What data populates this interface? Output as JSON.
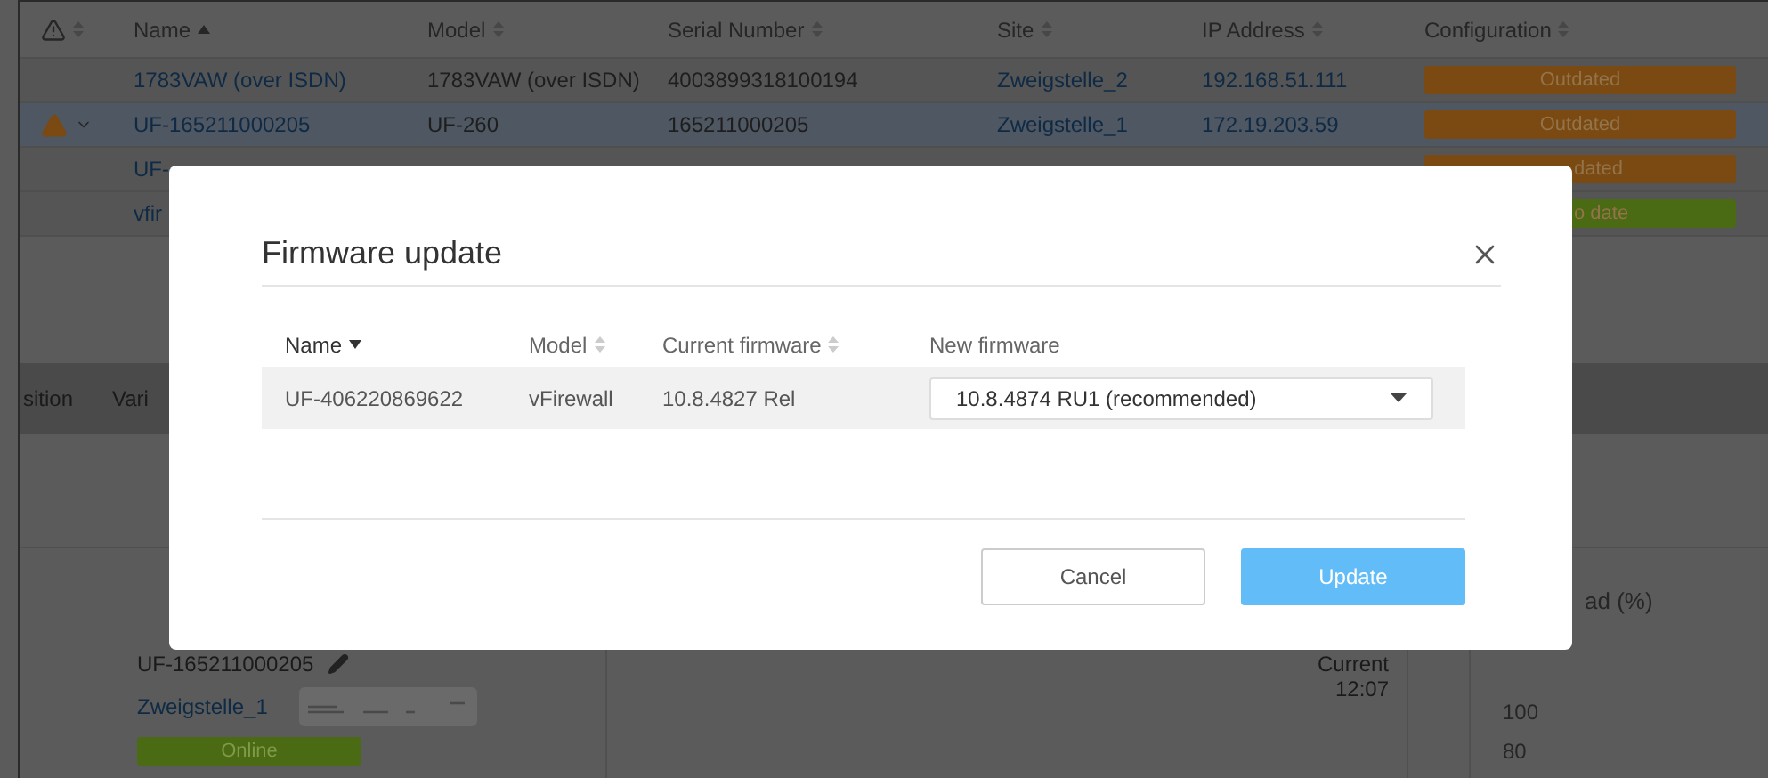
{
  "table": {
    "columns": [
      {
        "kind": "alert",
        "sortable": true,
        "sorted": false
      },
      {
        "kind": "text",
        "label": "Name",
        "sortable": true,
        "sorted": true
      },
      {
        "kind": "text",
        "label": "Model",
        "sortable": true,
        "sorted": false
      },
      {
        "kind": "text",
        "label": "Serial Number",
        "sortable": true,
        "sorted": false
      },
      {
        "kind": "text",
        "label": "Site",
        "sortable": true,
        "sorted": false
      },
      {
        "kind": "text",
        "label": "IP Address",
        "sortable": true,
        "sorted": false
      },
      {
        "kind": "text",
        "label": "Configuration",
        "sortable": true,
        "sorted": false
      }
    ],
    "rows": [
      {
        "selected": false,
        "alert": false,
        "name": "1783VAW (over ISDN)",
        "model": "1783VAW (over ISDN)",
        "serial": "4003899318100194",
        "site": "Zweigstelle_2",
        "ip": "192.168.51.111",
        "config": {
          "label": "Outdated",
          "color": "#7a4a12"
        }
      },
      {
        "selected": true,
        "alert": true,
        "name": "UF-165211000205",
        "model": "UF-260",
        "serial": "165211000205",
        "site": "Zweigstelle_1",
        "ip": "172.19.203.59",
        "config": {
          "label": "Outdated",
          "color": "#7a4a12"
        }
      },
      {
        "selected": false,
        "alert": false,
        "name": "UF-",
        "config": {
          "label": "dated",
          "color": "#7a4a12"
        }
      },
      {
        "selected": false,
        "alert": false,
        "name": "vfir",
        "config": {
          "label": "o date",
          "color": "#4b6a14"
        }
      }
    ]
  },
  "detail_tabs": [
    "sition",
    "Vari"
  ],
  "device": {
    "name": "UF-165211000205",
    "site": "Zweigstelle_1",
    "status": "Online"
  },
  "load_chart": {
    "title": "ad (%)",
    "current_label": "Current",
    "current_time": "12:07",
    "y_ticks": [
      "100",
      "80"
    ]
  },
  "modal": {
    "title": "Firmware update",
    "columns": [
      {
        "label": "Name",
        "sortable": true,
        "sorted": true
      },
      {
        "label": "Model",
        "sortable": true,
        "sorted": false
      },
      {
        "label": "Current firmware",
        "sortable": true,
        "sorted": false
      },
      {
        "label": "New firmware"
      }
    ],
    "rows": [
      {
        "name": "UF-406220869622",
        "model": "vFirewall",
        "current_firmware": "10.8.4827 Rel",
        "new_firmware": "10.8.4874 RU1 (recommended)"
      }
    ],
    "buttons": [
      {
        "kind": "secondary",
        "label": "Cancel"
      },
      {
        "kind": "primary",
        "label": "Update"
      }
    ]
  }
}
